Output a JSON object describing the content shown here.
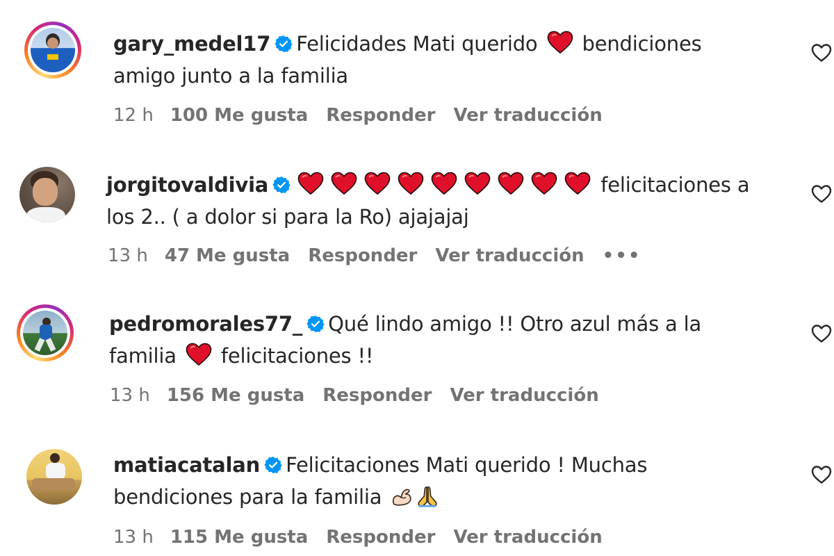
{
  "comments": [
    {
      "username": "gary_medel17",
      "text_before": "Felicidades Mati querido",
      "text_after": "bendiciones",
      "text_line2": "amigo junto a la familia",
      "time": "12 h",
      "likes": "100 Me gusta",
      "reply": "Responder",
      "translate": "Ver traducción"
    },
    {
      "username": "jorgitovaldivia",
      "heart_count": 9,
      "text_after": "felicitaciones a",
      "text_line2": "los 2.. ( a dolor si para la Ro) ajajajaj",
      "time": "13 h",
      "likes": "47 Me gusta",
      "reply": "Responder",
      "translate": "Ver traducción",
      "more": "•••"
    },
    {
      "username": "pedromorales77_",
      "text_line1": "Qué lindo amigo !! Otro azul más a la",
      "text_line2_before": "familia",
      "text_line2_after": "felicitaciones !!",
      "time": "13 h",
      "likes": "156 Me gusta",
      "reply": "Responder",
      "translate": "Ver traducción"
    },
    {
      "username": "matiacatalan",
      "text_line1": "Felicitaciones Mati querido ! Muchas",
      "text_line2": "bendiciones para la familia",
      "time": "13 h",
      "likes": "115 Me gusta",
      "reply": "Responder",
      "translate": "Ver traducción"
    }
  ],
  "icons": {
    "verified": "verified-badge-icon",
    "like": "heart-outline-icon",
    "emoji_heart": "red-heart-emoji",
    "emoji_muscle": "flexed-biceps-emoji",
    "emoji_pray": "folded-hands-emoji"
  },
  "colors": {
    "verified_blue": "#0095f6",
    "heart_red": "#e0102a",
    "meta_gray": "#737373",
    "text": "#262626"
  }
}
